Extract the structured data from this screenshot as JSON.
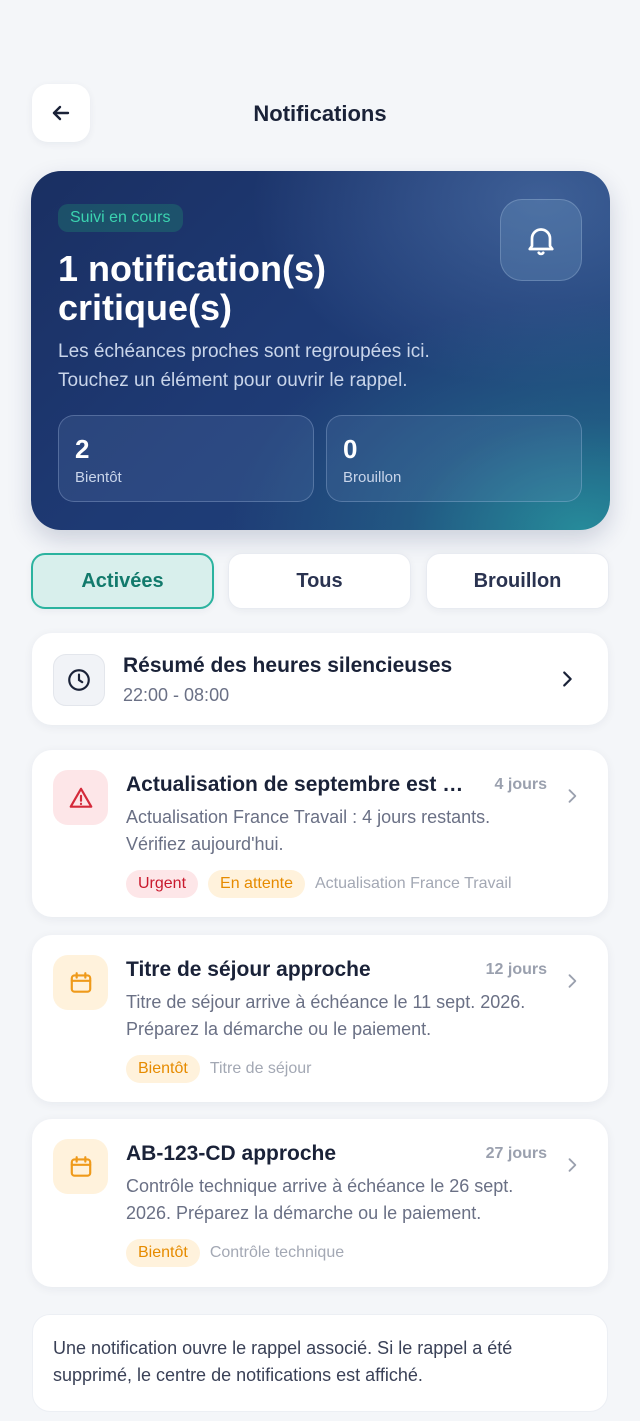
{
  "header": {
    "title": "Notifications",
    "back_icon": "arrow-left-icon"
  },
  "hero": {
    "badge": "Suivi en cours",
    "title": "1 notification(s) critique(s)",
    "description_line1": "Les échéances proches sont regroupées ici.",
    "description_line2": "Touchez un élément pour ouvrir le rappel.",
    "bell_icon": "bell-icon",
    "stats": [
      {
        "value": "2",
        "label": "Bientôt"
      },
      {
        "value": "0",
        "label": "Brouillon"
      }
    ]
  },
  "tabs": [
    {
      "label": "Activées",
      "active": true
    },
    {
      "label": "Tous",
      "active": false
    },
    {
      "label": "Brouillon",
      "active": false
    }
  ],
  "quiet_hours": {
    "title": "Résumé des heures silencieuses",
    "time": "22:00 - 08:00",
    "icon": "clock-icon"
  },
  "notifications": [
    {
      "title": "Actualisation de septembre est en retard",
      "days": "4 jours",
      "desc_line1": "Actualisation France Travail : 4 jours restants.",
      "desc_line2": "Vérifiez aujourd'hui.",
      "icon": "warning-icon",
      "tags": [
        "Urgent",
        "En attente"
      ],
      "source": "Actualisation France Travail"
    },
    {
      "title": "Titre de séjour approche",
      "days": "12 jours",
      "desc_line1": "Titre de séjour arrive à échéance le 11 sept. 2026.",
      "desc_line2": "Préparez la démarche ou le paiement.",
      "icon": "calendar-icon",
      "tags": [
        "Bientôt"
      ],
      "source": "Titre de séjour"
    },
    {
      "title": "AB-123-CD approche",
      "days": "27 jours",
      "desc_line1": "Contrôle technique arrive à échéance le 26 sept.",
      "desc_line2": "2026. Préparez la démarche ou le paiement.",
      "icon": "calendar-icon",
      "tags": [
        "Bientôt"
      ],
      "source": "Contrôle technique"
    }
  ],
  "footer": {
    "line1": "Une notification ouvre le rappel associé. Si le rappel a été",
    "line2": "supprimé, le centre de notifications est affiché."
  },
  "colors": {
    "accent": "#2bb39f",
    "hero_dark": "#1a2f62",
    "urgent": "#c9192d",
    "warning": "#e68b00"
  }
}
